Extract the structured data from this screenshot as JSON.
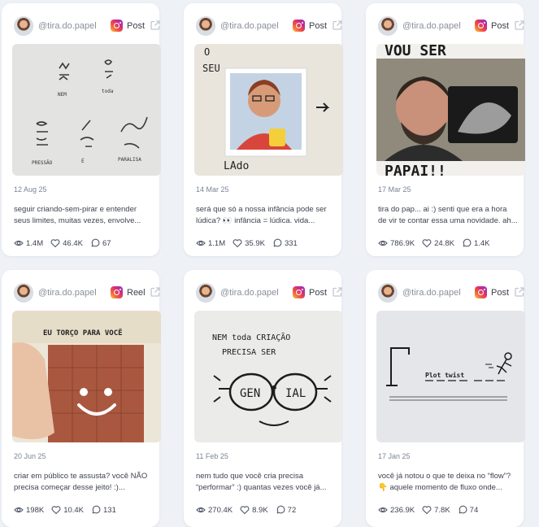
{
  "cards": [
    {
      "handle": "@tira.do.papel",
      "type": "Post",
      "date": "12 Aug 25",
      "caption_line1": "seguir criando-sem-pirar e entender",
      "caption_line2": "seus limites, muitas vezes, envolve...",
      "views": "1.4M",
      "likes": "46.4K",
      "comments": "67",
      "image": {
        "words": [
          "NEM",
          "toda",
          "PRESSÃO",
          "É",
          "PARALISA"
        ]
      }
    },
    {
      "handle": "@tira.do.papel",
      "type": "Post",
      "date": "14 Mar 25",
      "caption_line1": "será que só a nossa infância pode ser",
      "caption_line2": "lúdica? 👀 infância = lúdica. vida...",
      "views": "1.1M",
      "likes": "35.9K",
      "comments": "331",
      "image": {
        "words": [
          "O",
          "SEU",
          "LAdo"
        ]
      }
    },
    {
      "handle": "@tira.do.papel",
      "type": "Post",
      "date": "17 Mar 25",
      "caption_line1": "tira do pap... ai :) senti que era a hora",
      "caption_line2": "de vir te contar essa uma novidade. ah...",
      "views": "786.9K",
      "likes": "24.8K",
      "comments": "1.4K",
      "image": {
        "words": [
          "VOU SER",
          "PAPAI!!"
        ]
      }
    },
    {
      "handle": "@tira.do.papel",
      "type": "Reel",
      "date": "20 Jun 25",
      "caption_line1": "criar em público te assusta? você NÃO",
      "caption_line2": "precisa começar desse jeito! :)...",
      "views": "198K",
      "likes": "10.4K",
      "comments": "131",
      "image": {
        "words": [
          "EU TORÇO PARA VOCÊ"
        ]
      }
    },
    {
      "handle": "@tira.do.papel",
      "type": "Post",
      "date": "11 Feb 25",
      "caption_line1": "nem tudo que você cria precisa",
      "caption_line2": "“performar” :) quantas vezes você já...",
      "views": "270.4K",
      "likes": "8.9K",
      "comments": "72",
      "image": {
        "words": [
          "NEM toda CRIAÇÃO",
          "PRECISA SER",
          "GEN",
          "IAL"
        ]
      }
    },
    {
      "handle": "@tira.do.papel",
      "type": "Post",
      "date": "17 Jan 25",
      "caption_line1": "você já notou o que te deixa no “flow”?",
      "caption_line2": "👇 aquele momento de fluxo onde...",
      "views": "236.9K",
      "likes": "7.8K",
      "comments": "74",
      "image": {
        "words": [
          "Plot twist"
        ]
      }
    }
  ],
  "icons": {
    "platform": "instagram-icon",
    "external": "external-link-icon",
    "views": "eye-icon",
    "likes": "heart-icon",
    "comments": "comment-icon"
  },
  "colors": {
    "background": "#eef1f6",
    "card": "#ffffff",
    "muted_text": "#8a8f9c"
  }
}
